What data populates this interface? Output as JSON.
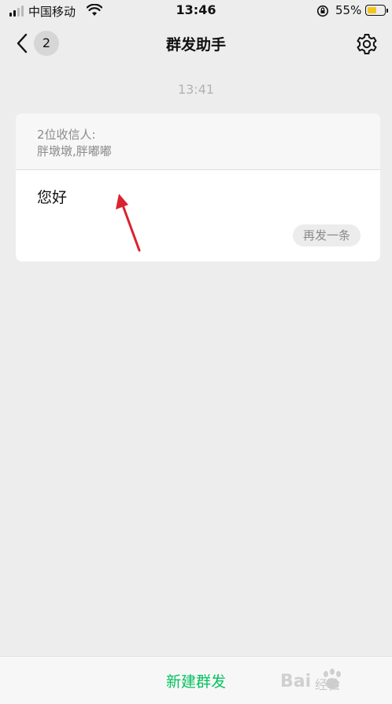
{
  "status_bar": {
    "carrier": "中国移动",
    "time": "13:46",
    "battery_percent": "55%",
    "battery_level": 0.55,
    "battery_color": "#f5c518",
    "icons": [
      "signal-icon",
      "wifi-icon",
      "orientation-lock-icon",
      "battery-icon"
    ]
  },
  "nav": {
    "back_badge": "2",
    "title": "群发助手",
    "icons": [
      "back-chevron-icon",
      "settings-gear-icon"
    ]
  },
  "chat": {
    "timestamp": "13:41",
    "card": {
      "recipients_count": "2位收信人:",
      "recipients_names": "胖墩墩,胖嘟嘟",
      "message": "您好",
      "resend_label": "再发一条"
    }
  },
  "bottom": {
    "new_broadcast_label": "新建群发"
  },
  "watermark": {
    "text": "经验"
  },
  "colors": {
    "accent_green": "#07c160",
    "annotation_red": "#d9232e",
    "background": "#ededed"
  }
}
